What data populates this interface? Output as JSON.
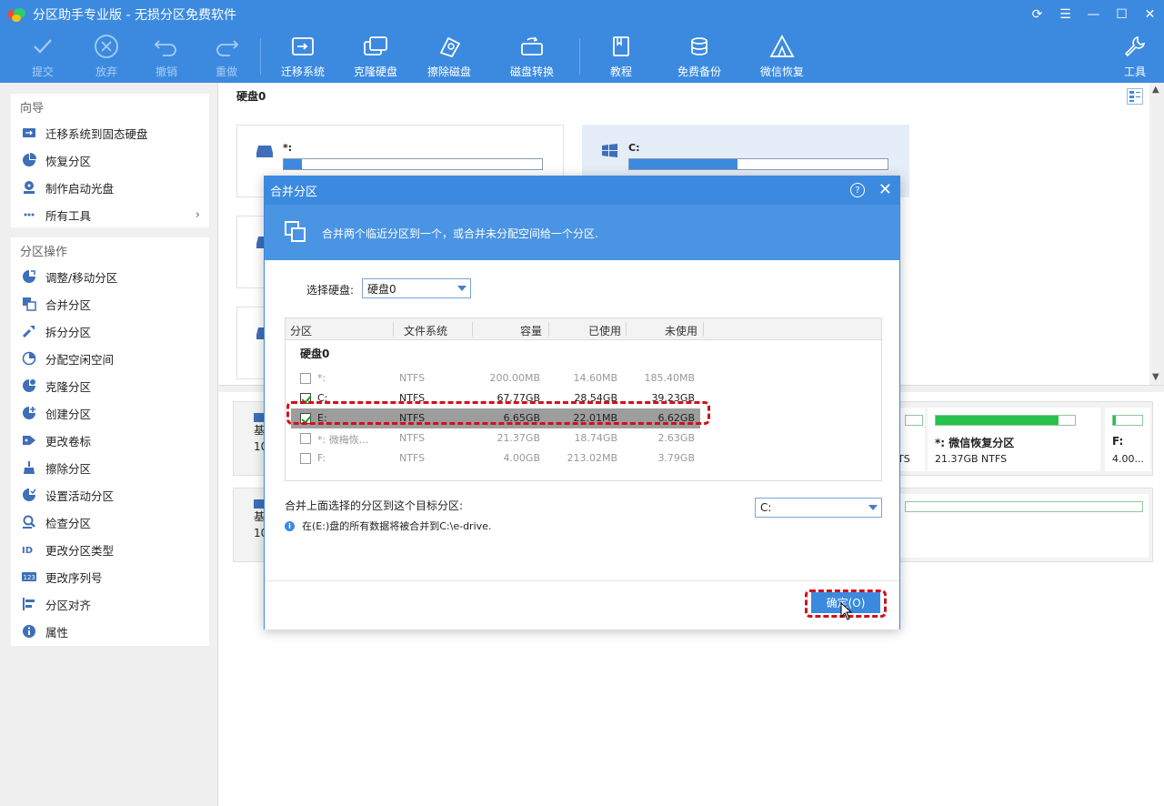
{
  "window": {
    "title": "分区助手专业版 - 无损分区免费软件"
  },
  "toolbar": {
    "commit": "提交",
    "discard": "放弃",
    "undo": "撤销",
    "redo": "重做",
    "migrate_os": "迁移系统",
    "clone_disk": "克隆硬盘",
    "wipe_disk": "擦除磁盘",
    "disk_convert": "磁盘转换",
    "tutorial": "教程",
    "free_backup": "免费备份",
    "wechat_restore": "微信恢复",
    "tools": "工具"
  },
  "sidebar": {
    "wizard_header": "向导",
    "wizard_items": [
      {
        "label": "迁移系统到固态硬盘",
        "icon": "disk-migrate-icon"
      },
      {
        "label": "恢复分区",
        "icon": "pie-restore-icon"
      },
      {
        "label": "制作启动光盘",
        "icon": "boot-disc-icon"
      },
      {
        "label": "所有工具",
        "icon": "all-tools-icon"
      }
    ],
    "ops_header": "分区操作",
    "ops_items": [
      {
        "label": "调整/移动分区",
        "icon": "resize-icon"
      },
      {
        "label": "合并分区",
        "icon": "merge-icon"
      },
      {
        "label": "拆分分区",
        "icon": "split-icon"
      },
      {
        "label": "分配空闲空间",
        "icon": "allocate-icon"
      },
      {
        "label": "克隆分区",
        "icon": "clone-icon"
      },
      {
        "label": "创建分区",
        "icon": "create-icon"
      },
      {
        "label": "更改卷标",
        "icon": "label-icon"
      },
      {
        "label": "擦除分区",
        "icon": "wipe-icon"
      },
      {
        "label": "设置活动分区",
        "icon": "active-icon"
      },
      {
        "label": "检查分区",
        "icon": "check-icon"
      },
      {
        "label": "更改分区类型",
        "icon": "id-icon"
      },
      {
        "label": "更改序列号",
        "icon": "serial-icon"
      },
      {
        "label": "分区对齐",
        "icon": "align-icon"
      },
      {
        "label": "属性",
        "icon": "info-icon"
      }
    ]
  },
  "main": {
    "disk_title": "硬盘0",
    "cards": [
      {
        "name": "*:",
        "usage": 0.07
      },
      {
        "name": "C:",
        "usage": 0.42
      }
    ],
    "lower": {
      "row1_label": "基",
      "row1_sub": "10",
      "row2_label": "基",
      "row2_sub": "10",
      "frag_text": "TS",
      "wechat_part": {
        "name": "*: 微信恢复分区",
        "info": "21.37GB NTFS",
        "usage": 0.88
      },
      "f_part": {
        "name": "F:",
        "info": "4.00..."
      }
    }
  },
  "dialog": {
    "title": "合并分区",
    "help": "?",
    "close": "✕",
    "description": "合并两个临近分区到一个，或合并未分配空间给一个分区.",
    "select_disk_label": "选择硬盘:",
    "select_disk_value": "硬盘0",
    "columns": [
      "分区",
      "文件系统",
      "容量",
      "已使用",
      "未使用"
    ],
    "group": "硬盘0",
    "rows": [
      {
        "name": "*:",
        "fs": "NTFS",
        "size": "200.00MB",
        "used": "14.60MB",
        "free": "185.40MB",
        "checked": false,
        "state": "disabled"
      },
      {
        "name": "C:",
        "fs": "NTFS",
        "size": "67.77GB",
        "used": "28.54GB",
        "free": "39.23GB",
        "checked": true,
        "state": "active"
      },
      {
        "name": "E:",
        "fs": "NTFS",
        "size": "6.65GB",
        "used": "22.01MB",
        "free": "6.62GB",
        "checked": true,
        "state": "selected"
      },
      {
        "name": "*: 微梅恢...",
        "fs": "NTFS",
        "size": "21.37GB",
        "used": "18.74GB",
        "free": "2.63GB",
        "checked": false,
        "state": "disabled"
      },
      {
        "name": "F:",
        "fs": "NTFS",
        "size": "4.00GB",
        "used": "213.02MB",
        "free": "3.79GB",
        "checked": false,
        "state": "disabled"
      }
    ],
    "target_label": "合并上面选择的分区到这个目标分区:",
    "target_value": "C:",
    "info_text": "在(E:)盘的所有数据将被合并到C:\\e-drive.",
    "ok_label": "确定(O)"
  },
  "colors": {
    "accent": "#3c8ae0",
    "highlight": "#d0111b",
    "usage_green": "#27c24c"
  }
}
